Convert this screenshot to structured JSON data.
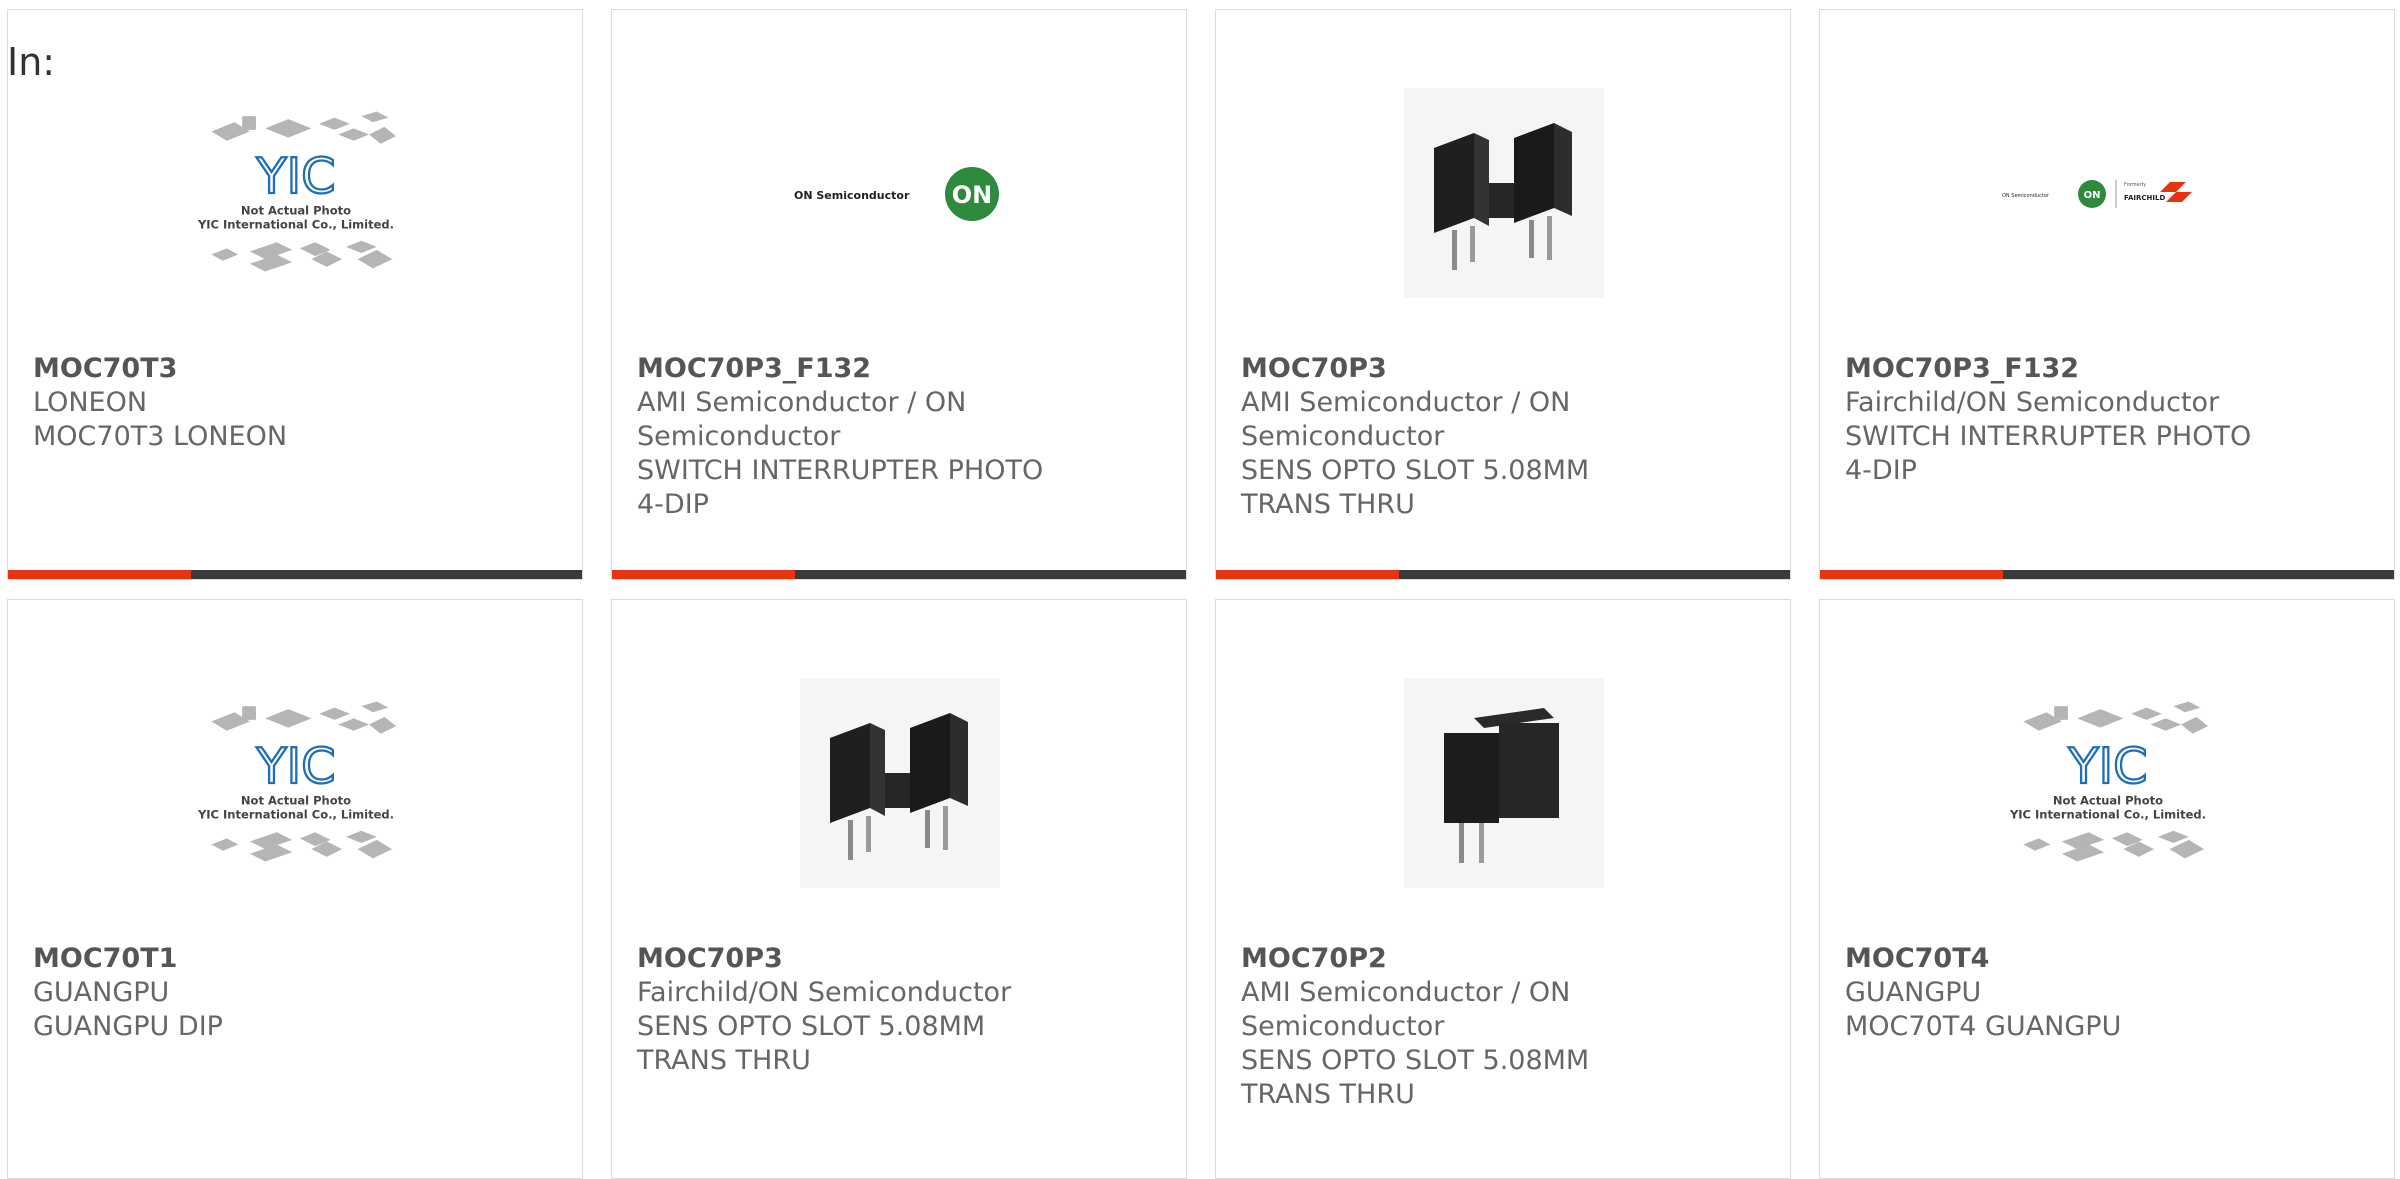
{
  "filter_label": "In:",
  "placeholder": {
    "caption_line1": "Not Actual Photo",
    "caption_line2": "YIC International Co., Limited.",
    "logo_text": "YIC"
  },
  "brand_logos": {
    "on_semi_text": "ON Semiconductor",
    "on_badge": "ON",
    "formerly": "Formerly",
    "fairchild": "FAIRCHILD"
  },
  "products": [
    {
      "part": "MOC70T3",
      "manufacturer": "LONEON",
      "description": "MOC70T3 LONEON",
      "image": "placeholder"
    },
    {
      "part": "MOC70P3_F132",
      "manufacturer": "AMI Semiconductor / ON Semiconductor",
      "description": "SWITCH INTERRUPTER PHOTO 4-DIP",
      "image": "on-semi-logo"
    },
    {
      "part": "MOC70P3",
      "manufacturer": "AMI Semiconductor / ON Semiconductor",
      "description": "SENS OPTO SLOT 5.08MM TRANS THRU",
      "image": "photo-interrupter"
    },
    {
      "part": "MOC70P3_F132",
      "manufacturer": "Fairchild/ON Semiconductor",
      "description": "SWITCH INTERRUPTER PHOTO 4-DIP",
      "image": "fairchild-on-logo"
    },
    {
      "part": "MOC70T1",
      "manufacturer": "GUANGPU",
      "description": "GUANGPU DIP",
      "image": "placeholder"
    },
    {
      "part": "MOC70P3",
      "manufacturer": "Fairchild/ON Semiconductor",
      "description": "SENS OPTO SLOT 5.08MM TRANS THRU",
      "image": "photo-interrupter"
    },
    {
      "part": "MOC70P2",
      "manufacturer": "AMI Semiconductor / ON Semiconductor",
      "description": "SENS OPTO SLOT 5.08MM TRANS THRU",
      "image": "photo-interrupter"
    },
    {
      "part": "MOC70T4",
      "manufacturer": "GUANGPU",
      "description": "MOC70T4 GUANGPU",
      "image": "placeholder"
    }
  ],
  "colors": {
    "accent": "#e63312",
    "bar": "#3a3a3a",
    "part_text": "#555555",
    "body_text": "#666666",
    "border": "#dcdcdc"
  }
}
